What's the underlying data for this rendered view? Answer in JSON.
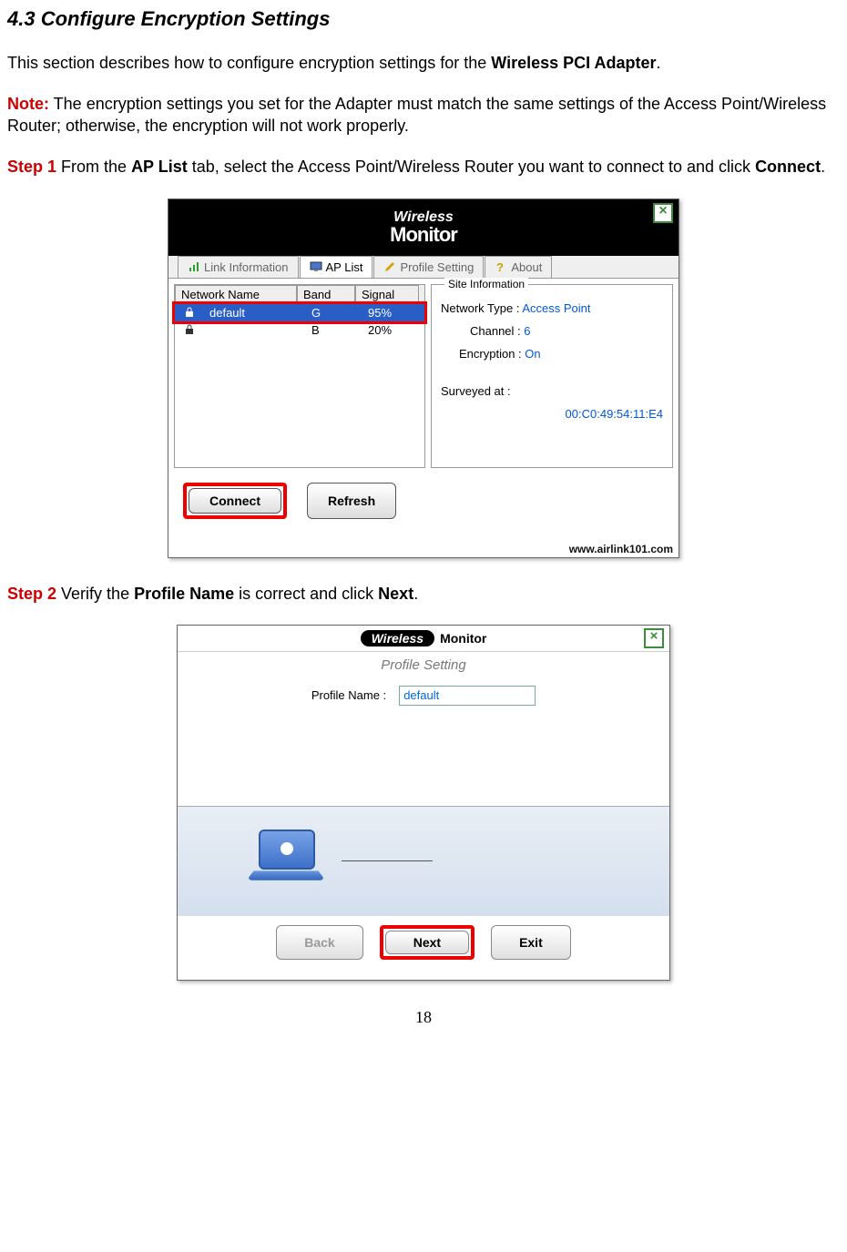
{
  "heading": "4.3 Configure Encryption Settings",
  "intro": {
    "prefix": "This section describes how to configure encryption settings for the ",
    "bold": "Wireless PCI Adapter",
    "suffix": "."
  },
  "note": {
    "label": "Note:",
    "text": " The encryption settings you set for the Adapter must match the same settings of the Access Point/Wireless Router; otherwise, the encryption will not work properly."
  },
  "step1": {
    "label": "Step 1",
    "p1": " From the ",
    "b1": "AP List",
    "p2": " tab, select the Access Point/Wireless Router you want to connect to and click ",
    "b2": "Connect",
    "p3": "."
  },
  "step2": {
    "label": "Step 2",
    "p1": " Verify the ",
    "b1": "Profile Name",
    "p2": " is correct and click ",
    "b2": "Next",
    "p3": "."
  },
  "win1": {
    "logo_top": "Wireless",
    "logo_bot": "Monitor",
    "tabs": {
      "link": "Link Information",
      "aplist": "AP List",
      "profile": "Profile Setting",
      "about": "About"
    },
    "cols": {
      "name": "Network Name",
      "band": "Band",
      "signal": "Signal"
    },
    "rows": [
      {
        "name": "default",
        "band": "G",
        "signal": "95%"
      },
      {
        "name": "",
        "band": "B",
        "signal": "20%"
      }
    ],
    "site": {
      "legend": "Site Information",
      "type_lbl": "Network Type :",
      "type_val": "Access Point",
      "chan_lbl": "Channel :",
      "chan_val": "6",
      "enc_lbl": "Encryption :",
      "enc_val": "On",
      "surv_lbl": "Surveyed at :",
      "surv_val": "00:C0:49:54:11:E4"
    },
    "connect_btn": "Connect",
    "refresh_btn": "Refresh",
    "footer": "www.airlink101.com"
  },
  "win2": {
    "wm_oval": "Wireless",
    "wm_black": "Monitor",
    "title": "Profile Setting",
    "profile_lbl": "Profile Name :",
    "profile_val": "default",
    "back": "Back",
    "next": "Next",
    "exit": "Exit"
  },
  "page_number": "18"
}
